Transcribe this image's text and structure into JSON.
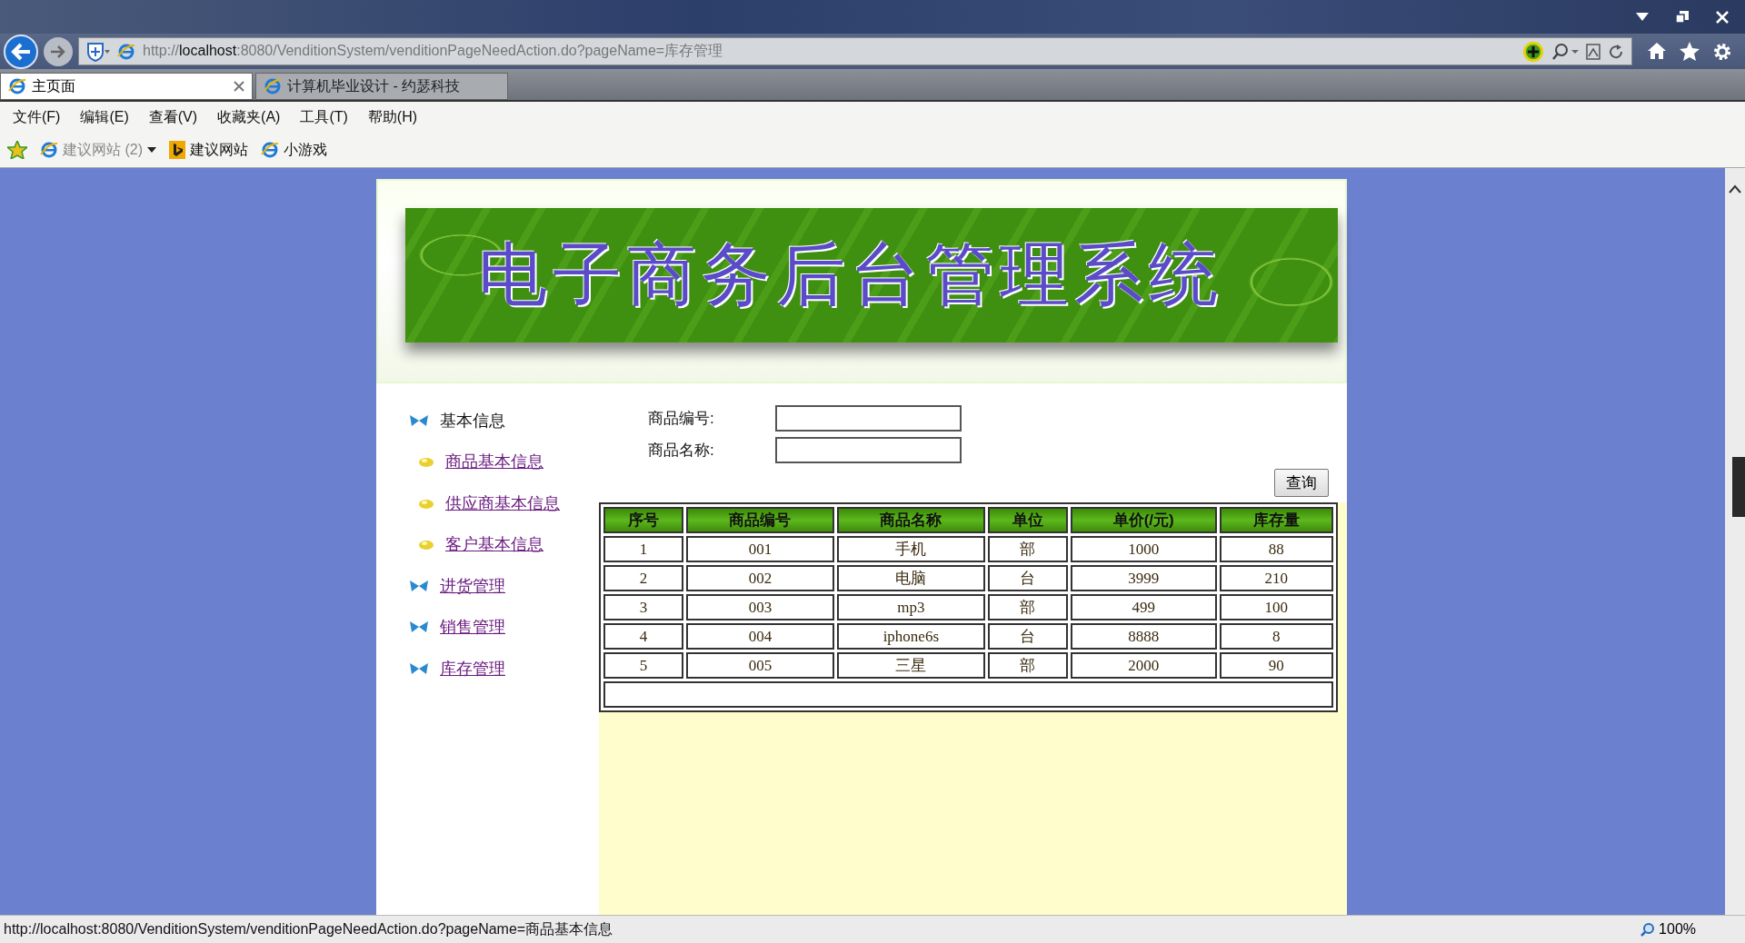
{
  "browser": {
    "address": "http://**localhost**:8080/VenditionSystem/venditionPageNeedAction.do?pageName=库存管理",
    "tabs": [
      {
        "label": "主页面",
        "selected": true
      },
      {
        "label": "计算机毕业设计 - 约瑟科技",
        "selected": false
      }
    ],
    "menu": [
      "文件(F)",
      "编辑(E)",
      "查看(V)",
      "收藏夹(A)",
      "工具(T)",
      "帮助(H)"
    ],
    "favorites": [
      {
        "label": "建议网站 (2)",
        "kind": "dropdown"
      },
      {
        "label": "建议网站",
        "kind": "bing"
      },
      {
        "label": "小游戏",
        "kind": "page"
      }
    ]
  },
  "page": {
    "banner_title": "电子商务后台管理系统",
    "sidebar": [
      {
        "label": "基本信息",
        "kind": "heading"
      },
      {
        "label": "商品基本信息",
        "kind": "sub-link"
      },
      {
        "label": "供应商基本信息",
        "kind": "sub-link"
      },
      {
        "label": "客户基本信息",
        "kind": "sub-link"
      },
      {
        "label": "进货管理",
        "kind": "link"
      },
      {
        "label": "销售管理",
        "kind": "link"
      },
      {
        "label": "库存管理",
        "kind": "link"
      }
    ],
    "search_fields": [
      {
        "label": "商品编号:"
      },
      {
        "label": "商品名称:"
      }
    ],
    "search_button": "查询",
    "table": {
      "columns": [
        "序号",
        "商品编号",
        "商品名称",
        "单位",
        "单价(/元)",
        "库存量"
      ],
      "rows": [
        [
          "1",
          "001",
          "手机",
          "部",
          "1000",
          "88"
        ],
        [
          "2",
          "002",
          "电脑",
          "台",
          "3999",
          "210"
        ],
        [
          "3",
          "003",
          "mp3",
          "部",
          "499",
          "100"
        ],
        [
          "4",
          "004",
          "iphone6s",
          "台",
          "8888",
          "8"
        ],
        [
          "5",
          "005",
          "三星",
          "部",
          "2000",
          "90"
        ]
      ]
    }
  },
  "status_bar": {
    "url": "http://localhost:8080/VenditionSystem/venditionPageNeedAction.do?pageName=商品基本信息",
    "zoom": "100%"
  }
}
